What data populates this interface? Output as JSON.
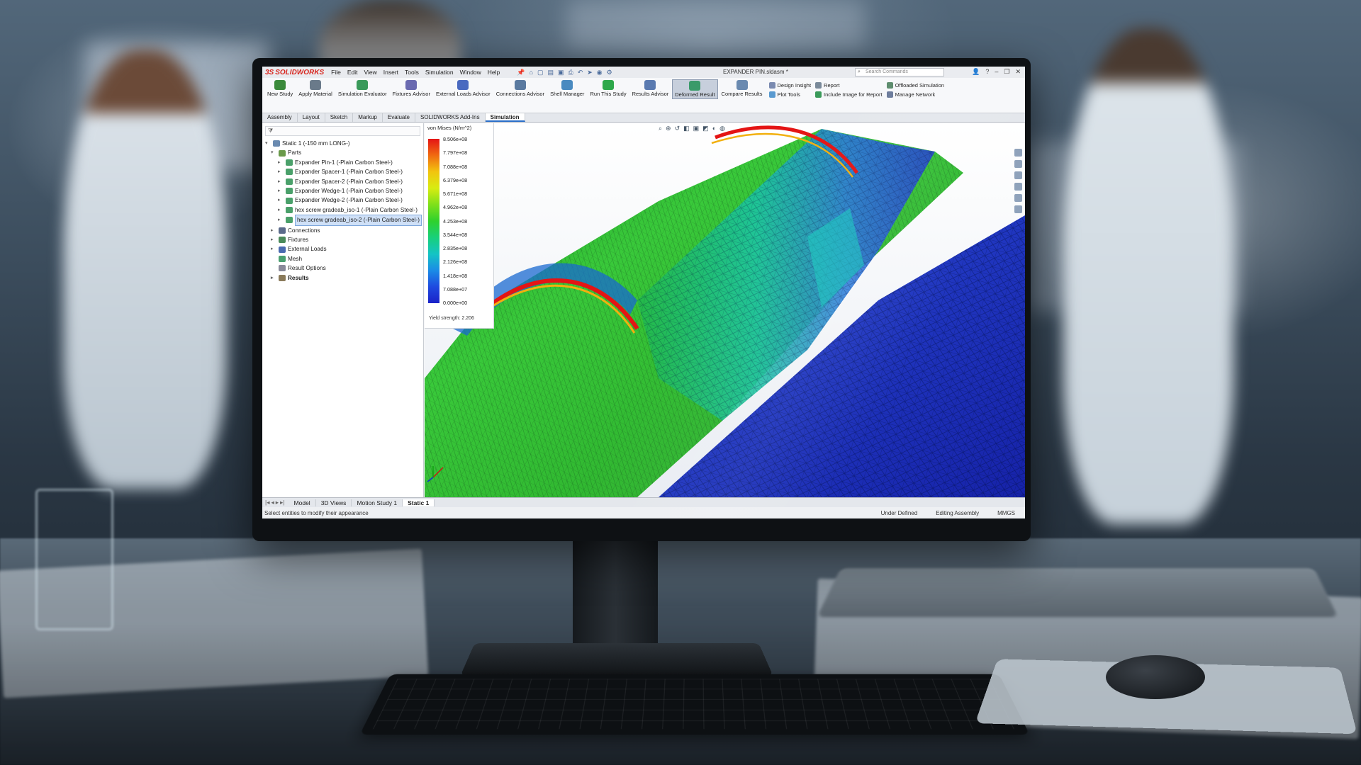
{
  "app": {
    "logo_text": "SOLIDWORKS",
    "document_title": "EXPANDER PIN.sldasm *",
    "search_placeholder": "Search Commands"
  },
  "menus": [
    "File",
    "Edit",
    "View",
    "Insert",
    "Tools",
    "Simulation",
    "Window",
    "Help"
  ],
  "ribbon": {
    "buttons": [
      {
        "label": "New Study",
        "color": "#3b8a3b"
      },
      {
        "label": "Apply Material",
        "color": "#6a7a8a"
      },
      {
        "label": "Simulation Evaluator",
        "color": "#3a9a5a"
      },
      {
        "label": "Fixtures Advisor",
        "color": "#6a6ab0"
      },
      {
        "label": "External Loads Advisor",
        "color": "#4a6ac0"
      },
      {
        "label": "Connections Advisor",
        "color": "#5a7aa0"
      },
      {
        "label": "Shell Manager",
        "color": "#4a8ac0"
      },
      {
        "label": "Run This Study",
        "color": "#2ea84a"
      },
      {
        "label": "Results Advisor",
        "color": "#5a7ab0"
      },
      {
        "label": "Deformed Result",
        "color": "#3a9a6a"
      },
      {
        "label": "Compare Results",
        "color": "#6a8ab0"
      }
    ],
    "col1": [
      "Design Insight",
      "Plot Tools"
    ],
    "col2": [
      "Report",
      "Include Image for Report"
    ],
    "col3": [
      "Offloaded Simulation",
      "Manage Network"
    ]
  },
  "command_tabs": [
    "Assembly",
    "Layout",
    "Sketch",
    "Markup",
    "Evaluate",
    "SOLIDWORKS Add-Ins",
    "Simulation"
  ],
  "tree": {
    "root": "Static 1 (-150 mm LONG-)",
    "parts_label": "Parts",
    "parts": [
      "Expander Pin-1 (-Plain Carbon Steel-)",
      "Expander Spacer-1 (-Plain Carbon Steel-)",
      "Expander Spacer-2 (-Plain Carbon Steel-)",
      "Expander Wedge-1 (-Plain Carbon Steel-)",
      "Expander Wedge-2 (-Plain Carbon Steel-)",
      "hex screw gradeab_iso-1 (-Plain Carbon Steel-)",
      "hex screw gradeab_iso-2 (-Plain Carbon Steel-)"
    ],
    "others": [
      "Connections",
      "Fixtures",
      "External Loads",
      "Mesh",
      "Result Options",
      "Results"
    ]
  },
  "legend": {
    "title": "von Mises (N/m^2)",
    "values": [
      "8.506e+08",
      "7.797e+08",
      "7.088e+08",
      "6.379e+08",
      "5.671e+08",
      "4.962e+08",
      "4.253e+08",
      "3.544e+08",
      "2.835e+08",
      "2.126e+08",
      "1.418e+08",
      "7.088e+07",
      "0.000e+00"
    ],
    "yield": "Yield strength: 2.206"
  },
  "bottom_tabs": [
    "Model",
    "3D Views",
    "Motion Study 1",
    "Static 1"
  ],
  "status": {
    "message": "Select entities to modify their appearance",
    "defined": "Under Defined",
    "mode": "Editing Assembly",
    "units": "MMGS"
  },
  "colors": {
    "accent": "#2a6fc9",
    "brand": "#d8261e"
  }
}
